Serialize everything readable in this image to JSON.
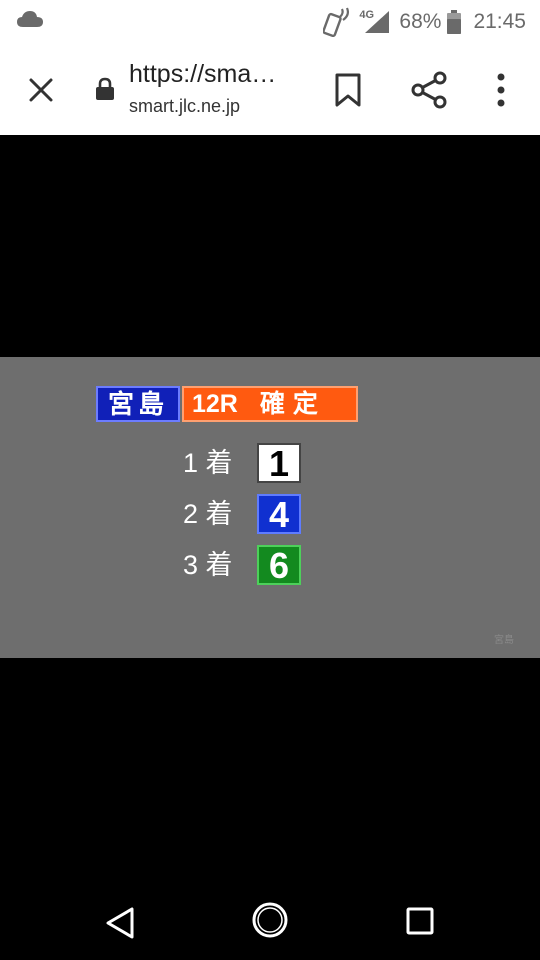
{
  "status_bar": {
    "network": "4G",
    "battery": "68%",
    "time": "21:45"
  },
  "browser": {
    "page_title": "https://sma…",
    "domain": "smart.jlc.ne.jp"
  },
  "result": {
    "venue": "宮島",
    "race": "12R",
    "status": "確定",
    "finishers": [
      {
        "place": "1 着",
        "boat": "1"
      },
      {
        "place": "2 着",
        "boat": "4"
      },
      {
        "place": "3 着",
        "boat": "6"
      }
    ],
    "watermark": "宮島"
  },
  "colors": {
    "venue_bg": "#1020b8",
    "race_bg": "#ff5a10",
    "boat_1": "#ffffff",
    "boat_4": "#1030d0",
    "boat_6": "#138a1f",
    "panel_bg": "#6e6e6e"
  }
}
